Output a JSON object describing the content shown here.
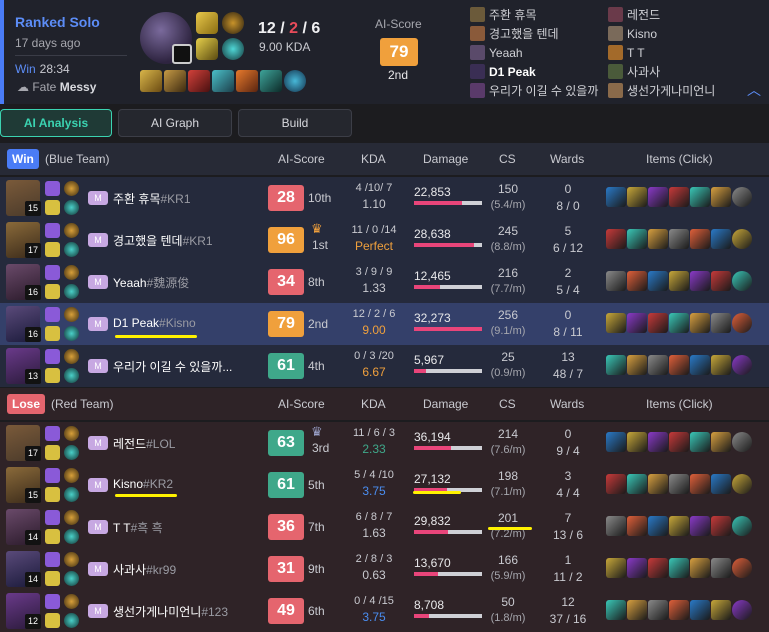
{
  "header": {
    "mode": "Ranked Solo",
    "ago": "17 days ago",
    "result": "Win",
    "duration": "28:34",
    "fate_label": "Fate",
    "fate_name": "Messy",
    "kills": "12",
    "deaths": "2",
    "assists": "6",
    "kda_ratio": "9.00 KDA",
    "ai_score_label": "AI-Score",
    "ai_score": "79",
    "ai_rank": "2nd",
    "collapse_icon": "chevron-up-icon"
  },
  "roster_left": [
    "주환 휴목",
    "경고했을 텐데",
    "Yeaah",
    "D1 Peak",
    "우리가 이길 수 있을까"
  ],
  "roster_right": [
    "레전드",
    "Kisno",
    "T T",
    "사과사",
    "생선가게나미언니"
  ],
  "tabs": [
    "AI Analysis",
    "AI Graph",
    "Build"
  ],
  "columns": {
    "ai_score": "AI-Score",
    "kda": "KDA",
    "damage": "Damage",
    "cs": "CS",
    "wards": "Wards",
    "items": "Items (Click)"
  },
  "blue": {
    "badge": "Win",
    "team_label": "(Blue Team)",
    "players": [
      {
        "level": "15",
        "mtag": "M",
        "name": "주환 휴목",
        "tag": "#KR1",
        "score": "28",
        "rank": "10th",
        "kda": "4 /10/ 7",
        "ratio": "1.10",
        "damage": "22,853",
        "dmg_frac": 0.7,
        "cs": "150",
        "cspm": "(5.4/m)",
        "wards": "0",
        "wards2": "8 / 0"
      },
      {
        "level": "17",
        "mtag": "M",
        "name": "경고했을 텐데",
        "tag": "#KR1",
        "score": "96",
        "rank": "1st",
        "kda": "11 / 0 /14",
        "ratio": "Perfect",
        "damage": "28,638",
        "dmg_frac": 0.88,
        "cs": "245",
        "cspm": "(8.8/m)",
        "wards": "5",
        "wards2": "6 / 12"
      },
      {
        "level": "16",
        "mtag": "M",
        "name": "Yeaah",
        "tag": "#魏源俊",
        "score": "34",
        "rank": "8th",
        "kda": "3 / 9 / 9",
        "ratio": "1.33",
        "damage": "12,465",
        "dmg_frac": 0.38,
        "cs": "216",
        "cspm": "(7.7/m)",
        "wards": "2",
        "wards2": "5 / 4"
      },
      {
        "level": "16",
        "mtag": "M",
        "name": "D1 Peak",
        "tag": "#Kisno",
        "score": "79",
        "rank": "2nd",
        "kda": "12 / 2 / 6",
        "ratio": "9.00",
        "damage": "32,273",
        "dmg_frac": 1.0,
        "cs": "256",
        "cspm": "(9.1/m)",
        "wards": "0",
        "wards2": "8 / 11"
      },
      {
        "level": "13",
        "mtag": "M",
        "name": "우리가 이길 수 있을까...",
        "tag": "",
        "score": "61",
        "rank": "4th",
        "kda": "0 / 3 /20",
        "ratio": "6.67",
        "damage": "5,967",
        "dmg_frac": 0.18,
        "cs": "25",
        "cspm": "(0.9/m)",
        "wards": "13",
        "wards2": "48 / 7"
      }
    ]
  },
  "red": {
    "badge": "Lose",
    "team_label": "(Red Team)",
    "players": [
      {
        "level": "17",
        "mtag": "M",
        "name": "레전드",
        "tag": "#LOL",
        "score": "63",
        "rank": "3rd",
        "kda": "11 / 6 / 3",
        "ratio": "2.33",
        "damage": "36,194",
        "dmg_frac": 0.55,
        "cs": "214",
        "cspm": "(7.6/m)",
        "wards": "0",
        "wards2": "9 / 4"
      },
      {
        "level": "15",
        "mtag": "M",
        "name": "Kisno",
        "tag": "#KR2",
        "score": "61",
        "rank": "5th",
        "kda": "5 / 4 /10",
        "ratio": "3.75",
        "damage": "27,132",
        "dmg_frac": 0.48,
        "cs": "198",
        "cspm": "(7.1/m)",
        "wards": "3",
        "wards2": "4 / 4"
      },
      {
        "level": "14",
        "mtag": "M",
        "name": "T T",
        "tag": "#흑 흑",
        "score": "36",
        "rank": "7th",
        "kda": "6 / 8 / 7",
        "ratio": "1.63",
        "damage": "29,832",
        "dmg_frac": 0.5,
        "cs": "201",
        "cspm": "(7.2/m)",
        "wards": "7",
        "wards2": "13 / 6"
      },
      {
        "level": "14",
        "mtag": "M",
        "name": "사과사",
        "tag": "#kr99",
        "score": "31",
        "rank": "9th",
        "kda": "2 / 8 / 3",
        "ratio": "0.63",
        "damage": "13,670",
        "dmg_frac": 0.35,
        "cs": "166",
        "cspm": "(5.9/m)",
        "wards": "1",
        "wards2": "11 / 2"
      },
      {
        "level": "12",
        "mtag": "M",
        "name": "생선가게나미언니",
        "tag": "#123",
        "score": "49",
        "rank": "6th",
        "kda": "0 / 4 /15",
        "ratio": "3.75",
        "damage": "8,708",
        "dmg_frac": 0.22,
        "cs": "50",
        "cspm": "(1.8/m)",
        "wards": "12",
        "wards2": "37 / 16"
      }
    ]
  },
  "colors": {
    "blue_accent": "#4a7cf6",
    "teal_accent": "#3bd3b1",
    "red_score": "#e5656e",
    "orange_score": "#f0a03c",
    "green_score": "#3fa88a",
    "perfect": "#f0a03c",
    "underline": "#fff200"
  }
}
